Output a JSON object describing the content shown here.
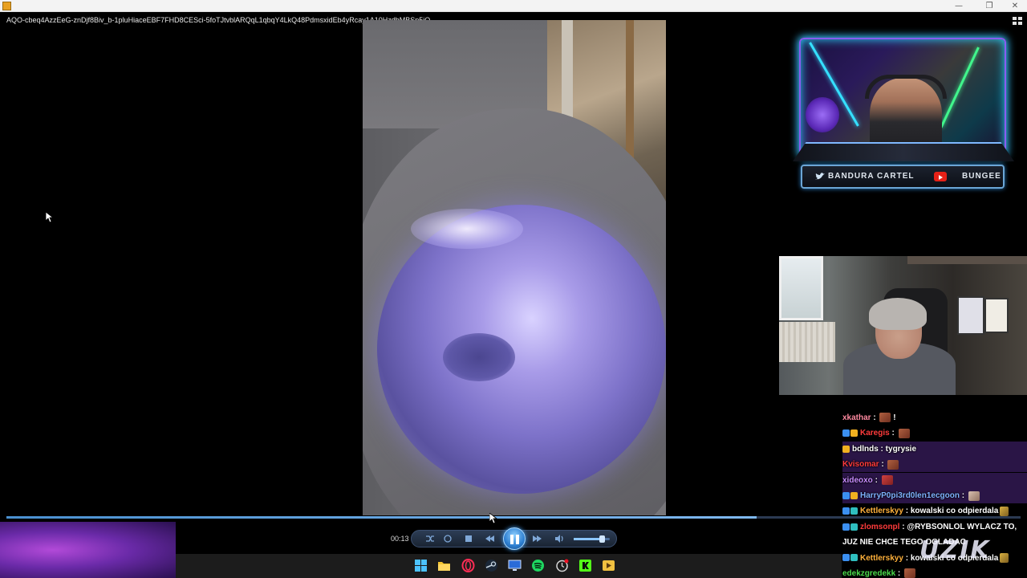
{
  "window": {
    "file_title": "AQO-cbeq4AzzEeG-znDjf8Biv_b-1pluHiaceEBF7FHD8CESci-5foTJtvblARQqL1qbqY4LkQ48PdmsxidEb4yRcay1A10HzdbMBSp5jQ",
    "minimize_glyph": "—",
    "maximize_glyph": "❐",
    "close_glyph": "✕"
  },
  "overlay": {
    "social_left": "BANDURA CARTEL",
    "social_right": "BUNGEE"
  },
  "player": {
    "time": "00:13",
    "progress": 0.74,
    "volume": 0.8
  },
  "chat": [
    {
      "user": "xkathar",
      "color": "#ff8aa0",
      "badges": [],
      "text": "",
      "emote": "e1",
      "suffix": "!"
    },
    {
      "user": "Karegis",
      "color": "#ff3b3b",
      "badges": [
        "blue",
        "gold"
      ],
      "text": "",
      "emote": "e1",
      "suffix": ""
    },
    {
      "user": "bdlnds",
      "color": "#ffffff",
      "badges": [
        "gold"
      ],
      "text": "tygrysie",
      "emote": "",
      "suffix": ""
    },
    {
      "user": "Kvisomar",
      "color": "#ff3b3b",
      "badges": [],
      "text": "",
      "emote": "e1",
      "suffix": ""
    },
    {
      "user": "xideoxo",
      "color": "#c88cff",
      "badges": [],
      "text": "",
      "emote": "e2",
      "suffix": ""
    },
    {
      "user": "HarryP0pi3rd0len1ecgoon",
      "color": "#7fb2ff",
      "badges": [
        "blue",
        "gold"
      ],
      "text": "",
      "emote": "e3",
      "suffix": ""
    },
    {
      "user": "Kettlerskyy",
      "color": "#ffb13b",
      "badges": [
        "blue",
        "teal"
      ],
      "text": "kowalski co odpierdala",
      "emote": "e4",
      "suffix": ""
    },
    {
      "user": "zlomsonpl",
      "color": "#ff3b3b",
      "badges": [
        "blue",
        "teal"
      ],
      "text": "@RYBSONLOL WYLACZ TO,",
      "emote": "",
      "suffix": ""
    },
    {
      "user": "",
      "color": "#ffffff",
      "badges": [],
      "text": "JUZ NIE CHCE TEGO OGLADAC",
      "emote": "",
      "suffix": ""
    },
    {
      "user": "Kettlerskyy",
      "color": "#ffb13b",
      "badges": [
        "blue",
        "teal"
      ],
      "text": "kowalski co odpierdala",
      "emote": "e4",
      "suffix": ""
    },
    {
      "user": "edekzgredekk",
      "color": "#4bdb4b",
      "badges": [],
      "text": "",
      "emote": "e1",
      "suffix": ""
    }
  ],
  "watermark": "UZIK",
  "taskbar_icons": [
    "windows-start-icon",
    "file-explorer-icon",
    "opera-gx-icon",
    "steam-icon",
    "monitor-icon",
    "spotify-icon",
    "clock-app-icon",
    "kick-icon",
    "media-player-icon"
  ]
}
